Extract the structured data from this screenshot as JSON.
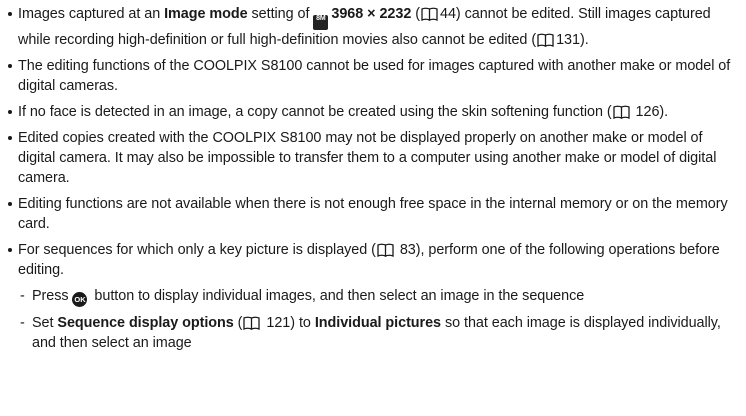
{
  "bullets": {
    "b1": {
      "t1": "Images captured at an ",
      "bold1": "Image mode",
      "t2": " setting of ",
      "icon": "image-size-icon",
      "bold2": "3968 × 2232",
      "ref1": "44",
      "t3": ") cannot be edited. Still images captured while recording high-definition or full high-definition movies also cannot be edited (",
      "ref2": "131",
      "t4": ")."
    },
    "b2": {
      "text": "The editing functions of the COOLPIX S8100 cannot be used for images captured with another make or model of digital cameras."
    },
    "b3": {
      "t1": "If no face is detected in an image, a copy cannot be created using the skin softening function (",
      "ref": "126",
      "t2": ")."
    },
    "b4": {
      "text": "Edited copies created with the COOLPIX S8100 may not be displayed properly on another make or model of digital camera. It may also be impossible to transfer them to a computer using another make or model of digital camera."
    },
    "b5": {
      "text": "Editing functions are not available when there is not enough free space in the internal memory or on the memory card."
    },
    "b6": {
      "t1": "For sequences for which only a key picture is displayed (",
      "ref": "83",
      "t2": "), perform one of the following operations before editing.",
      "sub1": {
        "t1": "Press ",
        "ok_label": "OK",
        "t2": " button to display individual images, and then select an image in the sequence"
      },
      "sub2": {
        "t1": "Set ",
        "bold1": "Sequence display options",
        "t2": " (",
        "ref": "121",
        "t3": ") to ",
        "bold2": "Individual pictures",
        "t4": " so that each image is displayed individually, and then select an image"
      }
    }
  },
  "icons": {
    "mode_icon_text": "8M",
    "book_icon": "book-reference-icon",
    "ok_icon": "ok-button-icon"
  }
}
